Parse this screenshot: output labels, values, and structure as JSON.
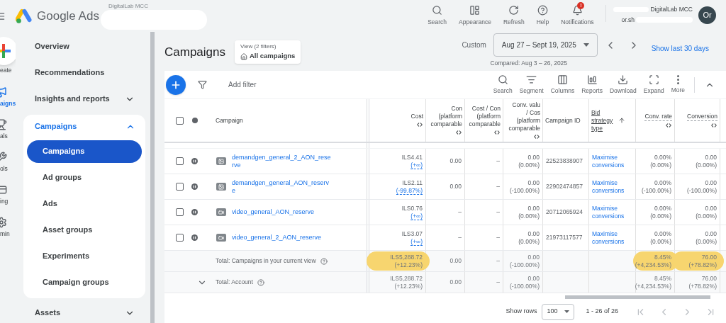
{
  "header": {
    "brand": "Google Ads",
    "account_path": "DigitalLab MCC",
    "actions": [
      {
        "label": "Search",
        "kind": "search"
      },
      {
        "label": "Appearance",
        "kind": "appearance"
      },
      {
        "label": "Refresh",
        "kind": "refresh"
      },
      {
        "label": "Help",
        "kind": "help"
      },
      {
        "label": "Notifications",
        "kind": "bell",
        "badge": "!"
      }
    ],
    "account": {
      "name": "DigitalLab MCC",
      "email": "or.sh",
      "avatar": "Or"
    }
  },
  "rail": [
    {
      "label": "eate",
      "kind": "create",
      "selected": false
    },
    {
      "label": "aigns",
      "kind": "campaigns",
      "selected": true
    },
    {
      "label": "als",
      "kind": "goals",
      "selected": false
    },
    {
      "label": "ols",
      "kind": "tools",
      "selected": false
    },
    {
      "label": "ing",
      "kind": "billing",
      "selected": false
    },
    {
      "label": "min",
      "kind": "admin",
      "selected": false
    }
  ],
  "sidebar": {
    "items": [
      {
        "label": "Overview"
      },
      {
        "label": "Recommendations"
      },
      {
        "label": "Insights and reports",
        "expanded": false
      },
      {
        "label": "Campaigns",
        "expanded": true,
        "children": [
          {
            "label": "Campaigns",
            "selected": true
          },
          {
            "label": "Ad groups",
            "selected": false
          },
          {
            "label": "Ads",
            "selected": false
          },
          {
            "label": "Asset groups",
            "selected": false
          },
          {
            "label": "Experiments",
            "selected": false
          },
          {
            "label": "Campaign groups",
            "selected": false
          }
        ]
      },
      {
        "label": "Assets",
        "expanded": false
      }
    ]
  },
  "page": {
    "title": "Campaigns",
    "view": {
      "label": "View (2 filters)",
      "value": "All campaigns"
    },
    "date": {
      "preset": "Custom",
      "range": "Aug 27 – Sept 19, 2025",
      "compared": "Compared: Aug 3 – 26, 2025",
      "show_last": "Show last 30 days"
    }
  },
  "table": {
    "filter": "Add filter",
    "tools": [
      {
        "label": "Search",
        "kind": "search"
      },
      {
        "label": "Segment",
        "kind": "segment"
      },
      {
        "label": "Columns",
        "kind": "columns"
      },
      {
        "label": "Reports",
        "kind": "reports"
      },
      {
        "label": "Download",
        "kind": "download"
      },
      {
        "label": "Expand",
        "kind": "expand"
      },
      {
        "label": "More",
        "kind": "more"
      }
    ],
    "header": {
      "checked": false,
      "campaign": "Campaign"
    },
    "columns": [
      {
        "lines": [
          "Cost"
        ],
        "kind": "metric"
      },
      {
        "lines": [
          "Con",
          "(platform",
          "comparable"
        ],
        "kind": "metric"
      },
      {
        "lines": [
          "Cost / Con",
          "(platform",
          "comparable"
        ],
        "kind": "metric"
      },
      {
        "lines": [
          "Conv. valu",
          "/ Cos",
          "(platform",
          "comparable"
        ],
        "kind": "metric"
      },
      {
        "lines": [
          "Campaign ID"
        ],
        "kind": "text"
      },
      {
        "lines": [
          "Bid",
          "strategy",
          "type"
        ],
        "kind": "sorted"
      },
      {
        "lines": [
          "Conv. rate"
        ],
        "kind": "measured"
      },
      {
        "lines": [
          "Conversion"
        ],
        "kind": "measured"
      }
    ],
    "rows": [
      {
        "checked": false,
        "paused": true,
        "kind": "demand_gen",
        "name": "demandgen_general_2_AON_reserve",
        "cells": [
          {
            "value": "ILS4.41",
            "change": "(+∞)",
            "change_link": true
          },
          {
            "value": "0.00"
          },
          {
            "value": "–"
          },
          {
            "value": "0.00",
            "change": "(0.00%)",
            "change_link": false
          },
          {
            "value": "22523838907"
          },
          {
            "value": "Maximise conversions",
            "link": true
          },
          {
            "value": "0.00%",
            "change": "(0.00%)",
            "change_link": false
          },
          {
            "value": "0.00",
            "change": "(0.00%)",
            "change_link": false
          }
        ]
      },
      {
        "checked": false,
        "paused": true,
        "kind": "demand_gen",
        "name": "demandgen_general_AON_reserve",
        "cells": [
          {
            "value": "ILS2.11",
            "change": "(-99.87%)",
            "change_link": true
          },
          {
            "value": "0.00"
          },
          {
            "value": "–"
          },
          {
            "value": "0.00",
            "change": "(-100.00%)",
            "change_link": false
          },
          {
            "value": "22902474857"
          },
          {
            "value": "Maximise conversions",
            "link": true
          },
          {
            "value": "0.00%",
            "change": "(-100.00%)",
            "change_link": false
          },
          {
            "value": "0.00",
            "change": "(-100.00%)",
            "change_link": false
          }
        ]
      },
      {
        "checked": false,
        "paused": true,
        "kind": "video",
        "name": "video_general_AON_reserve",
        "cells": [
          {
            "value": "ILS0.76",
            "change": "(+∞)",
            "change_link": true
          },
          {
            "value": "–"
          },
          {
            "value": "–"
          },
          {
            "value": "0.00",
            "change": "(0.00%)",
            "change_link": false
          },
          {
            "value": "20712065924"
          },
          {
            "value": "Maximise conversions",
            "link": true
          },
          {
            "value": "0.00%",
            "change": "(0.00%)",
            "change_link": false
          },
          {
            "value": "0.00",
            "change": "(0.00%)",
            "change_link": false
          }
        ]
      },
      {
        "checked": false,
        "paused": true,
        "kind": "video",
        "name": "video_general_2_AON_reserve",
        "cells": [
          {
            "value": "ILS3.07",
            "change": "(+∞)",
            "change_link": true
          },
          {
            "value": "–"
          },
          {
            "value": "–"
          },
          {
            "value": "0.00",
            "change": "(0.00%)",
            "change_link": false
          },
          {
            "value": "21973117577"
          },
          {
            "value": "Maximise conversions",
            "link": true
          },
          {
            "value": "0.00%",
            "change": "(0.00%)",
            "change_link": false
          },
          {
            "value": "0.00",
            "change": "(0.00%)",
            "change_link": false
          }
        ]
      }
    ],
    "totals": [
      {
        "label": "Total: Campaigns in your current view",
        "cells": [
          {
            "value": "ILS5,288.72",
            "change": "(+12.23%)",
            "change_link": false,
            "highlighted": true
          },
          {
            "value": "0.00"
          },
          {
            "value": "–"
          },
          {
            "value": "0.00",
            "change": "(-100.00%)",
            "change_link": false
          },
          {},
          {},
          {
            "value": "8.45%",
            "change": "(+4,234.53%)",
            "change_link": false,
            "highlighted": true
          },
          {
            "value": "76.00",
            "change": "(+78.82%)",
            "change_link": false,
            "highlighted": true
          }
        ]
      },
      {
        "label": "Total: Account",
        "expanded": false,
        "cells": [
          {
            "value": "ILS5,288.72",
            "change": "(+12.23%)",
            "change_link": false
          },
          {
            "value": "0.00"
          },
          {
            "value": "–"
          },
          {
            "value": "0.00",
            "change": "(-100.00%)",
            "change_link": false
          },
          {},
          {},
          {
            "value": "8.45%",
            "change": "(+4,234.53%)",
            "change_link": false
          },
          {
            "value": "76.00",
            "change": "(+78.82%)",
            "change_link": false
          }
        ]
      }
    ],
    "footer": {
      "show_rows_label": "Show rows",
      "rows_per_page": "100",
      "range": "1 - 26 of 26"
    }
  }
}
